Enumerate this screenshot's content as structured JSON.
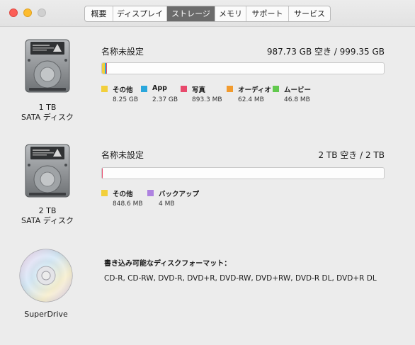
{
  "window": {
    "tabs": [
      {
        "label": "概要"
      },
      {
        "label": "ディスプレイ"
      },
      {
        "label": "ストレージ"
      },
      {
        "label": "メモリ"
      },
      {
        "label": "サポート"
      },
      {
        "label": "サービス"
      }
    ],
    "active_tab": "ストレージ"
  },
  "drives": [
    {
      "capacity": "1 TB",
      "type": "SATA ディスク",
      "volume_name": "名称未設定",
      "space_text": "987.73 GB 空き / 999.35 GB",
      "legend": [
        {
          "label": "その他",
          "size": "8.25 GB",
          "color": "#f2cf3b"
        },
        {
          "label": "App",
          "size": "2.37 GB",
          "color": "#2aa7dc"
        },
        {
          "label": "写真",
          "size": "893.3 MB",
          "color": "#e8496c"
        },
        {
          "label": "オーディオ",
          "size": "62.4 MB",
          "color": "#f29b2e"
        },
        {
          "label": "ムービー",
          "size": "46.8 MB",
          "color": "#62c94e"
        }
      ]
    },
    {
      "capacity": "2 TB",
      "type": "SATA ディスク",
      "volume_name": "名称未設定",
      "space_text": "2 TB 空き / 2 TB",
      "legend": [
        {
          "label": "その他",
          "size": "848.6 MB",
          "color": "#f2cf3b"
        },
        {
          "label": "バックアップ",
          "size": "4 MB",
          "color": "#ae82e0"
        }
      ]
    }
  ],
  "superdrive": {
    "label": "SuperDrive",
    "formats_title": "書き込み可能なディスクフォーマット：",
    "formats": "CD-R, CD-RW, DVD-R, DVD+R, DVD-RW, DVD+RW, DVD-R DL, DVD+R DL"
  }
}
